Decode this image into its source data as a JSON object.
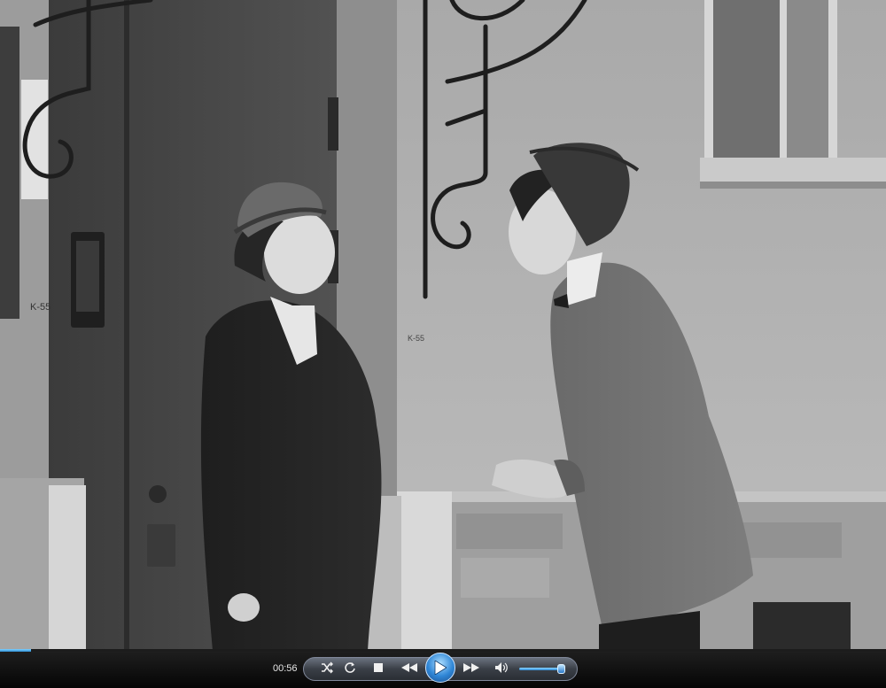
{
  "player": {
    "time_elapsed": "00:56",
    "seek_progress_fraction": 0.035,
    "volume_fraction": 0.9,
    "accent_color": "#2f86d6"
  },
  "video": {
    "door_sign_text": "K-55",
    "wall_mark_text": "K-55"
  },
  "controls": {
    "shuffle_icon": "shuffle-icon",
    "repeat_icon": "repeat-icon",
    "stop_icon": "stop-icon",
    "previous_icon": "previous-icon",
    "play_icon": "play-icon",
    "next_icon": "next-icon",
    "volume_icon": "speaker-icon"
  }
}
